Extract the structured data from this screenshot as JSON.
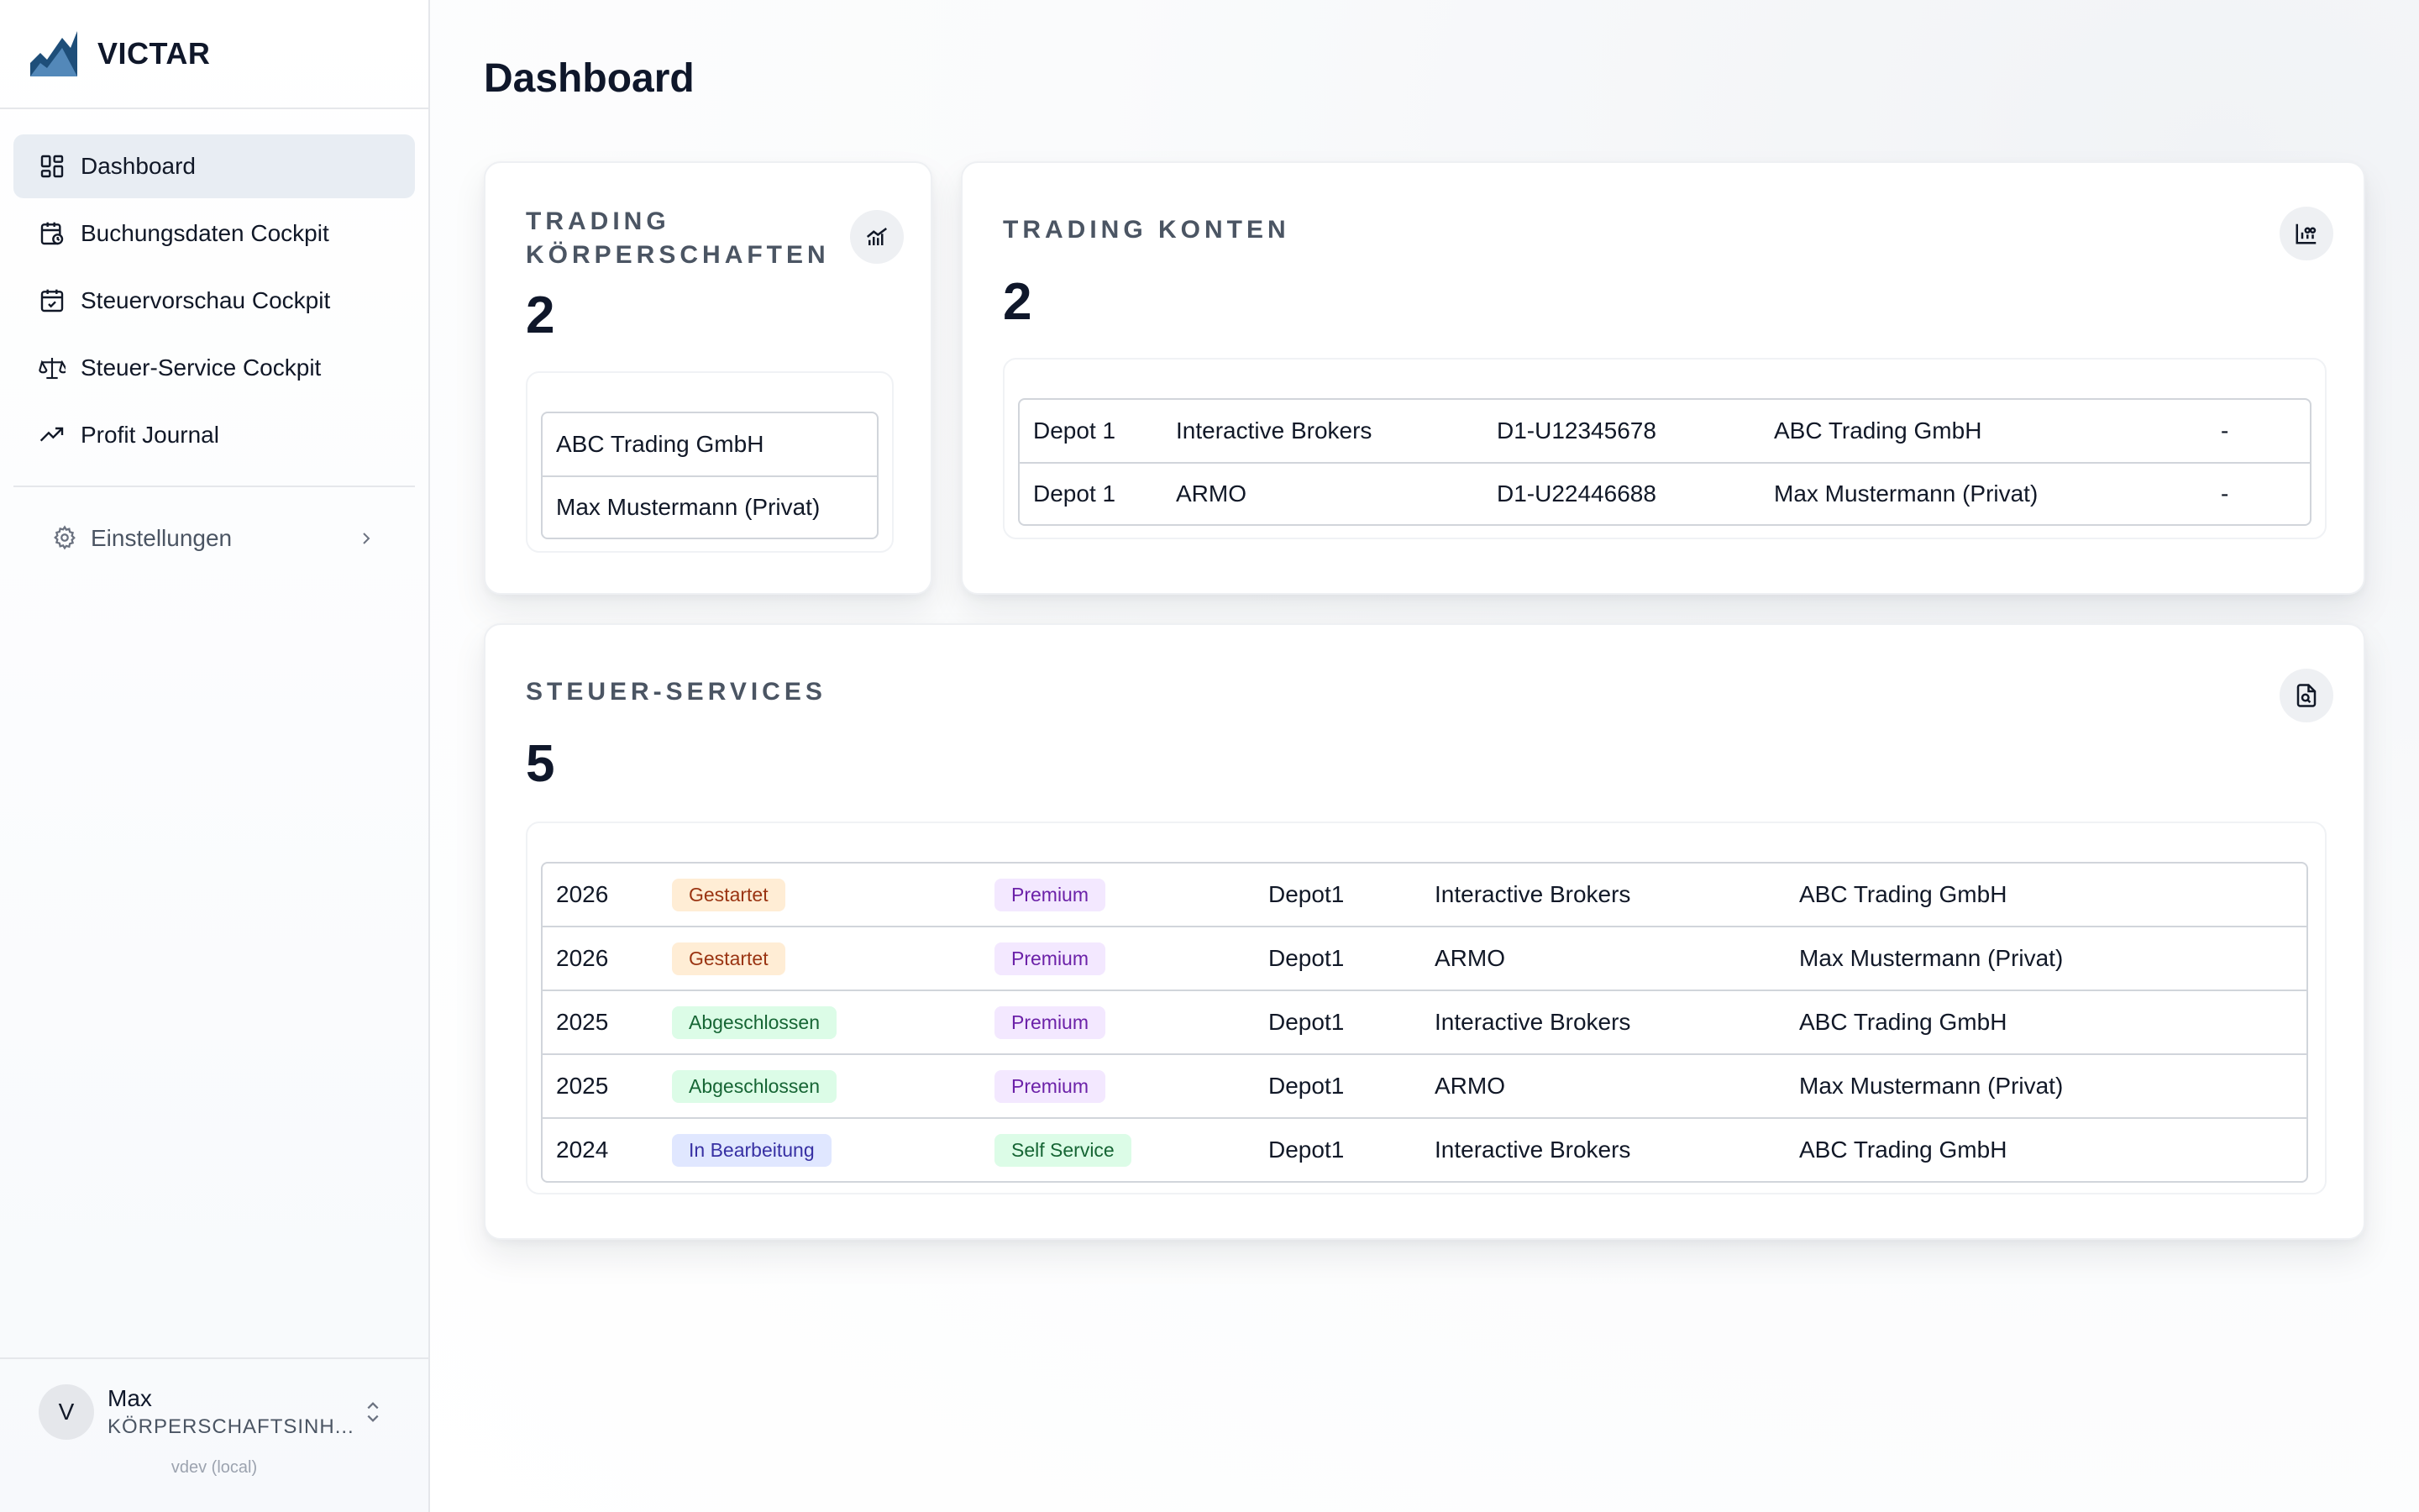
{
  "brand": {
    "name": "VICTAR"
  },
  "sidebar": {
    "items": [
      {
        "label": "Dashboard",
        "icon": "dashboard-icon",
        "active": true
      },
      {
        "label": "Buchungsdaten Cockpit",
        "icon": "calendar-clock-icon"
      },
      {
        "label": "Steuervorschau Cockpit",
        "icon": "calendar-check-icon"
      },
      {
        "label": "Steuer-Service Cockpit",
        "icon": "scale-icon"
      },
      {
        "label": "Profit Journal",
        "icon": "trending-up-icon"
      }
    ],
    "settings": {
      "label": "Einstellungen"
    },
    "user": {
      "initial": "V",
      "name": "Max",
      "role": "KÖRPERSCHAFTSINH...",
      "version": "vdev (local)"
    }
  },
  "page": {
    "title": "Dashboard"
  },
  "trading_koerperschaften": {
    "label_line1": "TRADING",
    "label_line2": "KÖRPERSCHAFTEN",
    "count": "2",
    "items": [
      "ABC Trading GmbH",
      "Max Mustermann (Privat)"
    ]
  },
  "trading_konten": {
    "label": "TRADING KONTEN",
    "count": "2",
    "rows": [
      {
        "depot": "Depot 1",
        "broker": "Interactive Brokers",
        "account": "D1-U12345678",
        "owner": "ABC Trading GmbH",
        "extra": "-"
      },
      {
        "depot": "Depot 1",
        "broker": "ARMO",
        "account": "D1-U22446688",
        "owner": "Max Mustermann (Privat)",
        "extra": "-"
      }
    ]
  },
  "steuer_services": {
    "label": "STEUER-SERVICES",
    "count": "5",
    "rows": [
      {
        "year": "2026",
        "status": "Gestartet",
        "plan": "Premium",
        "depot": "Depot1",
        "broker": "Interactive Brokers",
        "owner": "ABC Trading GmbH"
      },
      {
        "year": "2026",
        "status": "Gestartet",
        "plan": "Premium",
        "depot": "Depot1",
        "broker": "ARMO",
        "owner": "Max Mustermann (Privat)"
      },
      {
        "year": "2025",
        "status": "Abgeschlossen",
        "plan": "Premium",
        "depot": "Depot1",
        "broker": "Interactive Brokers",
        "owner": "ABC Trading GmbH"
      },
      {
        "year": "2025",
        "status": "Abgeschlossen",
        "plan": "Premium",
        "depot": "Depot1",
        "broker": "ARMO",
        "owner": "Max Mustermann (Privat)"
      },
      {
        "year": "2024",
        "status": "In Bearbeitung",
        "plan": "Self Service",
        "depot": "Depot1",
        "broker": "Interactive Brokers",
        "owner": "ABC Trading GmbH"
      }
    ]
  },
  "colors": {
    "status_gestartet": {
      "bg": "#ffedd5",
      "fg": "#9a3412"
    },
    "status_abgeschlossen": {
      "bg": "#dcfce7",
      "fg": "#166534"
    },
    "status_in_bearbeitung": {
      "bg": "#e0e7ff",
      "fg": "#3730a3"
    },
    "plan_premium": {
      "bg": "#f3e8ff",
      "fg": "#6b21a8"
    },
    "plan_self_service": {
      "bg": "#dcfce7",
      "fg": "#166534"
    },
    "brand_blue": "#1e4e79"
  }
}
